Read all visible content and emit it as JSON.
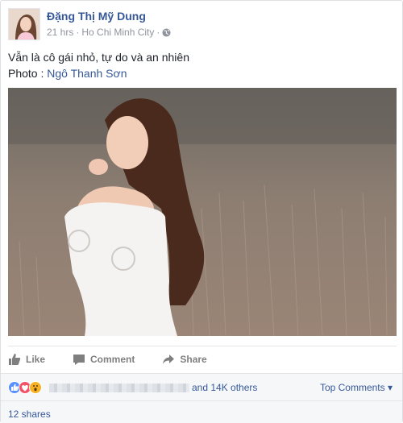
{
  "post": {
    "author": "Đặng Thị Mỹ Dung",
    "time": "21 hrs",
    "separator": "·",
    "location": "Ho Chi Minh City",
    "separator2": "·",
    "privacy_icon": "globe-icon",
    "text_line1": "Vẫn là cô gái nhỏ, tự do và an nhiên",
    "photo_label": "Photo : ",
    "photo_credit": "Ngô Thanh Sơn"
  },
  "actions": {
    "like": "Like",
    "comment": "Comment",
    "share": "Share"
  },
  "reactions": {
    "icons": [
      "like-reaction-icon",
      "love-reaction-icon",
      "wow-reaction-icon"
    ],
    "others": "and 14K others",
    "top_comments": "Top Comments ▾"
  },
  "shares": {
    "count": "12 shares"
  },
  "colors": {
    "link": "#365899",
    "muted": "#90949c",
    "like": "#5890ff",
    "love": "#f25268",
    "wow": "#f7b125"
  }
}
